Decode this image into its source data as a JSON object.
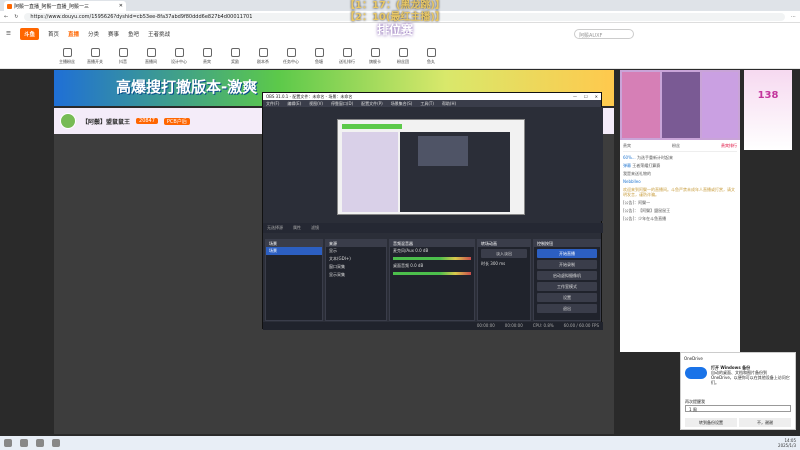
{
  "browser": {
    "tab_title": "阿鬃一直播_阿鬃一直播_阿鬃一三",
    "url": "https://www.douyu.com/1595626?dyshid=cb53ee-8fa37abd9f80ddd6e827b4d00011701"
  },
  "nav": {
    "logo": "斗鱼",
    "items": [
      "首页",
      "直播",
      "分类",
      "赛事",
      "鱼吧",
      "王者挑战"
    ],
    "active": "直播",
    "search_placeholder": "阿鬃AUXF"
  },
  "categories": [
    {
      "label": "主播粉丝"
    },
    {
      "label": "直播开关"
    },
    {
      "label": "抖音"
    },
    {
      "label": "直播间"
    },
    {
      "label": "设计中心"
    },
    {
      "label": "贵宾"
    },
    {
      "label": "奖励"
    },
    {
      "label": "剧本杀"
    },
    {
      "label": "任务中心"
    },
    {
      "label": "鱼塘"
    },
    {
      "label": "送礼排行"
    },
    {
      "label": "旗舰卡"
    },
    {
      "label": "粉丝团"
    },
    {
      "label": "鱼丸"
    }
  ],
  "overlay": {
    "line1": "【1：17：(黑龙跳)】",
    "line2": "【2：10(最红主播)】",
    "line3": "排位赛"
  },
  "banner": {
    "text": "高爆搜打撤版本-激爽"
  },
  "room": {
    "title": "【阿鬃】盟鼠鼠王",
    "badge": "PCB户后",
    "level": "20847"
  },
  "right": {
    "deco_text": "138"
  },
  "chat": {
    "tabs": [
      "贵宾",
      "粉丝",
      "贵宾排行"
    ],
    "lines": [
      {
        "user": "60%...",
        "text": "为选手重新计时起来"
      },
      {
        "user": "弹幕",
        "text": "王者荣耀打算赛"
      },
      {
        "user": "",
        "text": "我是来送礼物的"
      },
      {
        "user": "Nebblleo",
        "text": ""
      }
    ],
    "notice": "欢迎来到阿鬃一的直播间。斗鱼严禁未成年人直播或打赏，请文明发言，谨防诈骗。",
    "system": [
      "[公告]：阿鬃一",
      "[公告]：【阿鬃】盟鼠鼠王",
      "[公告]：少年在斗鱼直播"
    ]
  },
  "obs": {
    "title": "OBS 31.0.1 - 配置文件：未命名 - 场景：未命名",
    "menu": [
      "文件(F)",
      "编辑(E)",
      "视图(V)",
      "停靠窗口(D)",
      "配置文件(P)",
      "场景集合(S)",
      "工具(T)",
      "帮助(H)"
    ],
    "toolbar": [
      "无选择源",
      "属性",
      "滤镜"
    ],
    "scenes_header": "场景",
    "scene_item": "场景",
    "sources_header": "来源",
    "sources": [
      "显示",
      "文本(GDI+)",
      "窗口采集",
      "显示采集"
    ],
    "mixer_header": "音频混音器",
    "mixer": [
      {
        "name": "麦克风/Aux",
        "db": "0.0 dB"
      },
      {
        "name": "桌面音频",
        "db": "0.0 dB"
      }
    ],
    "transitions_header": "转场动画",
    "transition": "淡入淡出",
    "duration_label": "时长",
    "duration": "300 ms",
    "controls_header": "控制按钮",
    "controls": [
      "开始直播",
      "开始录制",
      "启动虚拟摄像机",
      "工作室模式",
      "设置",
      "退出"
    ],
    "status": [
      "00:00:00",
      "00:00:00",
      "CPU: 0.8%",
      "60.00 / 60.00 FPS"
    ]
  },
  "onedrive": {
    "app": "OneDrive",
    "title": "打开 Windows 备份",
    "body": "自动的桌面、文档和图片备份到 OneDrive，以便你可以在其他设备上访问它们。",
    "select_label": "再次提醒我",
    "select_value": "1 周",
    "btn_primary": "转到备份设置",
    "btn_secondary": "不，谢谢"
  },
  "taskbar": {
    "time": "14:05",
    "date": "2025/1/3"
  }
}
